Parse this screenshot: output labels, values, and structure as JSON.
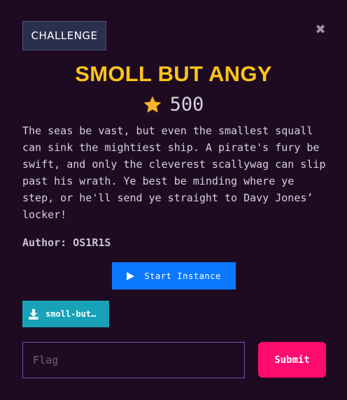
{
  "header": {
    "tab_label": "CHALLENGE",
    "close_symbol": "✖"
  },
  "challenge": {
    "title": "SMOLL BUT ANGY",
    "points": "500",
    "description": "The seas be vast, but even the smallest squall can sink the mightiest ship. A pirate's fury be swift, and only the cleverest scallywag can slip past his wrath. Ye best be minding where ye step, or he'll send ye straight to Davy Jones’ locker!",
    "author": "Author: OS1R1S"
  },
  "actions": {
    "start_instance_label": "Start Instance",
    "download_label": "smoll-but…"
  },
  "flag_form": {
    "placeholder": "Flag",
    "value": "",
    "submit_label": "Submit"
  },
  "colors": {
    "background": "#1e0b22",
    "title": "#ffc418",
    "start_button": "#0a78ff",
    "download_button": "#17a2b8",
    "submit_button": "#ff0a6e",
    "input_border": "#6a58a8"
  },
  "icons": {
    "close": "close-icon",
    "points": "star-icon",
    "start": "play-icon",
    "download": "download-icon"
  }
}
